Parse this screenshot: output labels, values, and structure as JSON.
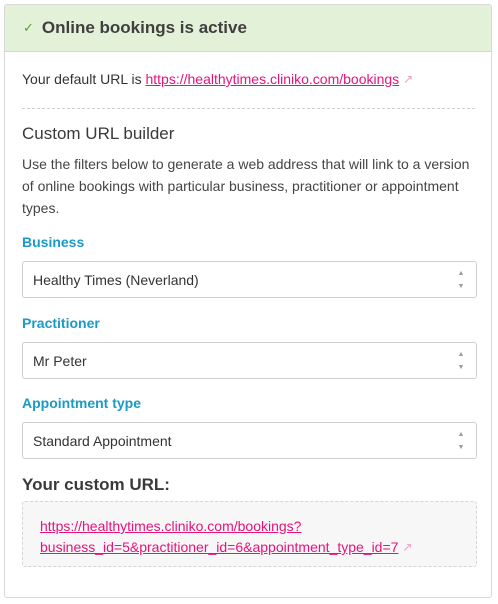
{
  "banner": {
    "title": "Online bookings is active",
    "check_icon": "checkmark-icon"
  },
  "default_url": {
    "prefix": "Your default URL is",
    "link": "https://healthytimes.cliniko.com/bookings"
  },
  "builder": {
    "title": "Custom URL builder",
    "description": "Use the filters below to generate a web address that will link to a version of online bookings with particular business, practitioner or appointment types."
  },
  "filters": {
    "business": {
      "label": "Business",
      "value": "Healthy Times (Neverland)"
    },
    "practitioner": {
      "label": "Practitioner",
      "value": "Mr Peter"
    },
    "appointment_type": {
      "label": "Appointment type",
      "value": "Standard Appointment"
    }
  },
  "custom_url": {
    "label": "Your custom URL:",
    "line1": "https://healthytimes.cliniko.com/bookings?",
    "line2": "business_id=5&practitioner_id=6&appointment_type_id=7"
  },
  "colors": {
    "accent_link": "#e8127c",
    "label_blue": "#1a9ac6",
    "banner_bg": "#e2f1d8"
  }
}
